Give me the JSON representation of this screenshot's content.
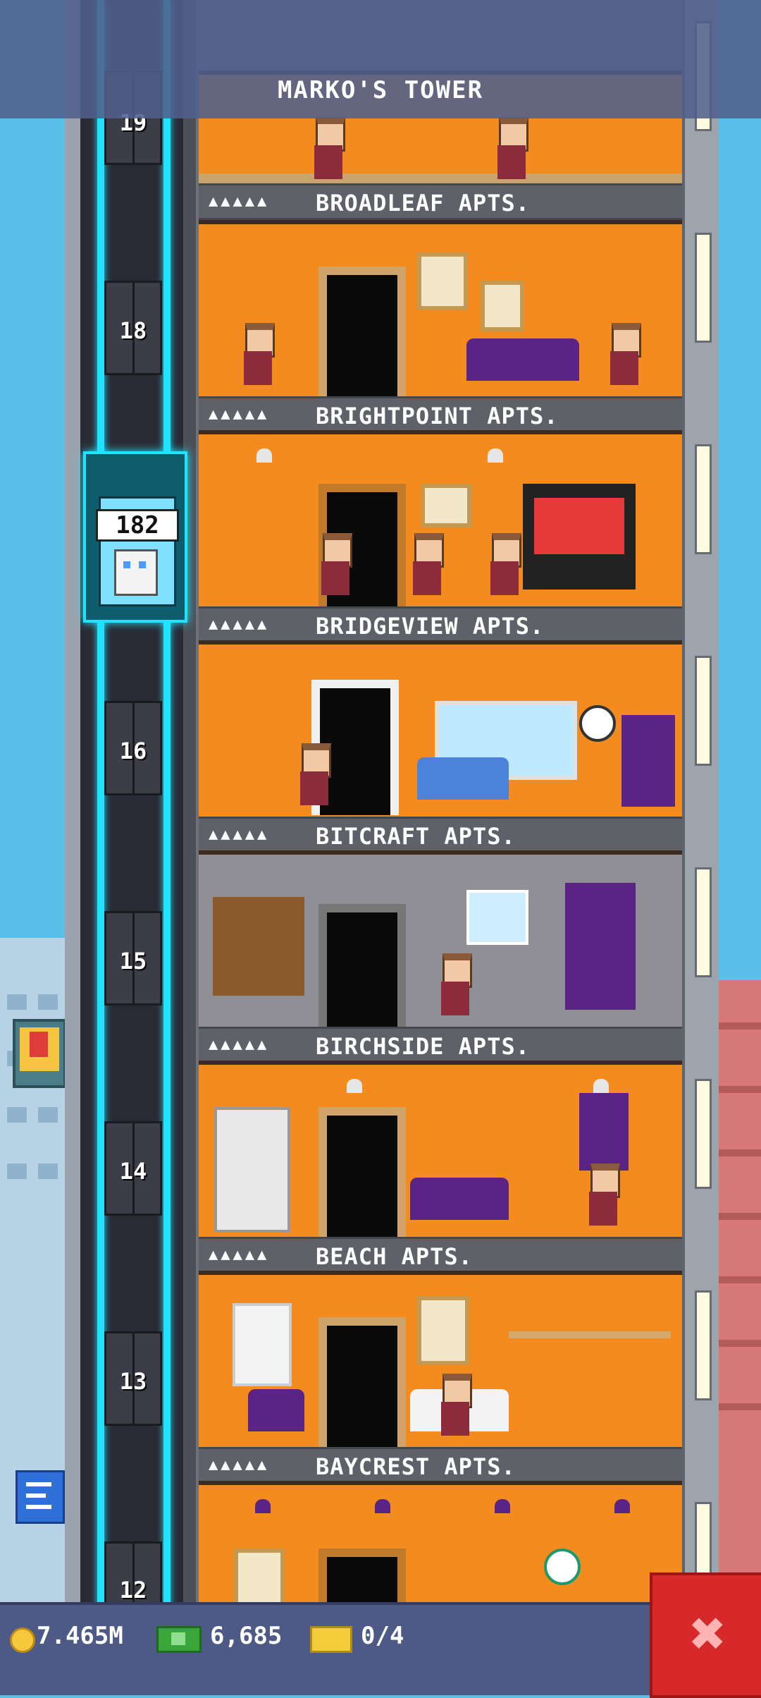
{
  "header": {
    "title": "MARKO'S TOWER"
  },
  "elevator": {
    "count": "182"
  },
  "shaft_floor_numbers": [
    {
      "num": "19",
      "cls": "f19"
    },
    {
      "num": "18",
      "cls": "f18"
    },
    {
      "num": "16",
      "cls": "f16"
    },
    {
      "num": "15",
      "cls": "f15"
    },
    {
      "num": "14",
      "cls": "f14"
    },
    {
      "num": "13",
      "cls": "f13"
    },
    {
      "num": "12",
      "cls": "f12"
    }
  ],
  "floors": [
    {
      "name": "BROADLEAF APTS.",
      "people": "▲▲▲▲▲"
    },
    {
      "name": "BRIGHTPOINT APTS.",
      "people": "▲▲▲▲▲"
    },
    {
      "name": "BRIDGEVIEW APTS.",
      "people": "▲▲▲▲▲"
    },
    {
      "name": "BITCRAFT APTS.",
      "people": "▲▲▲▲▲"
    },
    {
      "name": "BIRCHSIDE APTS.",
      "people": "▲▲▲▲▲"
    },
    {
      "name": "BEACH APTS.",
      "people": "▲▲▲▲▲"
    },
    {
      "name": "BAYCREST APTS.",
      "people": "▲▲▲▲▲"
    }
  ],
  "status_bar": {
    "coins": "7.465M",
    "bux": "6,685",
    "tickets": "0/4",
    "close_symbol": "✖"
  },
  "colors": {
    "floor_orange": "#f48b1e",
    "neon": "#21e3ff",
    "close_red": "#d72929"
  }
}
